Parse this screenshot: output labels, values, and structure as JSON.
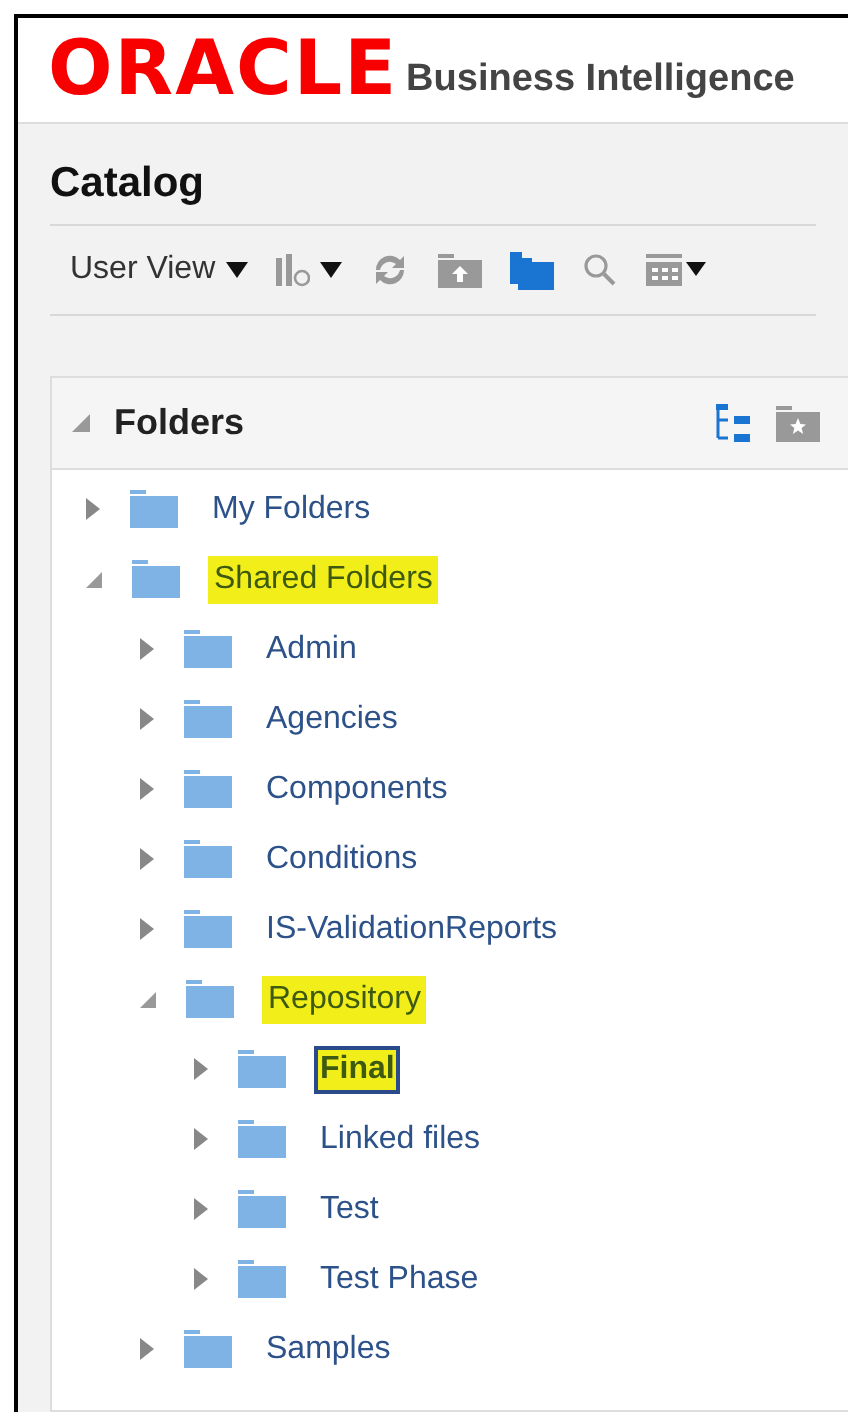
{
  "header": {
    "logo": "ORACLE",
    "product": "Business Intelligence"
  },
  "page_title": "Catalog",
  "toolbar": {
    "view_menu": "User View"
  },
  "folders_panel": {
    "title": "Folders",
    "expanded": true,
    "tree": [
      {
        "label": "My Folders",
        "expanded": false,
        "highlighted": false,
        "selected": false
      },
      {
        "label": "Shared Folders",
        "expanded": true,
        "highlighted": true,
        "selected": false,
        "children": [
          {
            "label": "Admin",
            "expanded": false,
            "highlighted": false,
            "selected": false
          },
          {
            "label": "Agencies",
            "expanded": false,
            "highlighted": false,
            "selected": false
          },
          {
            "label": "Components",
            "expanded": false,
            "highlighted": false,
            "selected": false
          },
          {
            "label": "Conditions",
            "expanded": false,
            "highlighted": false,
            "selected": false
          },
          {
            "label": "IS-ValidationReports",
            "expanded": false,
            "highlighted": false,
            "selected": false
          },
          {
            "label": "Repository",
            "expanded": true,
            "highlighted": true,
            "selected": false,
            "children": [
              {
                "label": "Final",
                "expanded": false,
                "highlighted": true,
                "selected": true
              },
              {
                "label": "Linked files",
                "expanded": false,
                "highlighted": false,
                "selected": false
              },
              {
                "label": "Test",
                "expanded": false,
                "highlighted": false,
                "selected": false
              },
              {
                "label": "Test Phase",
                "expanded": false,
                "highlighted": false,
                "selected": false
              }
            ]
          },
          {
            "label": "Samples",
            "expanded": false,
            "highlighted": false,
            "selected": false
          }
        ]
      }
    ]
  }
}
